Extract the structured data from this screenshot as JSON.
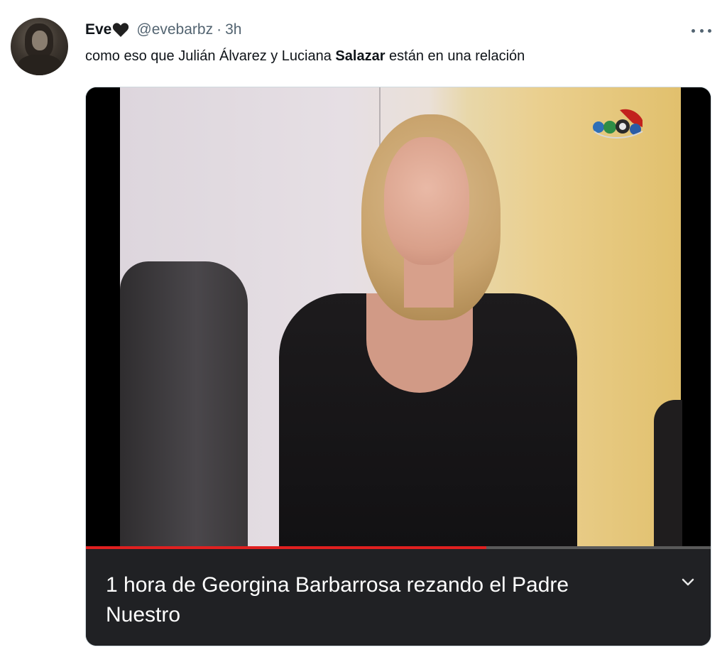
{
  "tweet": {
    "display_name": "Eve",
    "handle": "@evebarbz",
    "separator": "·",
    "time": "3h",
    "text_before": "como eso que Julián Álvarez y Luciana ",
    "text_bold": "Salazar",
    "text_after": " están en una relación"
  },
  "icons": {
    "heart": "black-heart-icon",
    "more": "more-options-icon",
    "chevron": "chevron-down-icon",
    "channel_logo": "channel-logo"
  },
  "video": {
    "progress_fraction": 0.64,
    "title": "1 hora de Georgina Barbarrosa rezando el Padre Nuestro"
  },
  "colors": {
    "progress": "#e02020",
    "caption_bg": "#202124",
    "secondary_text": "#536471"
  }
}
